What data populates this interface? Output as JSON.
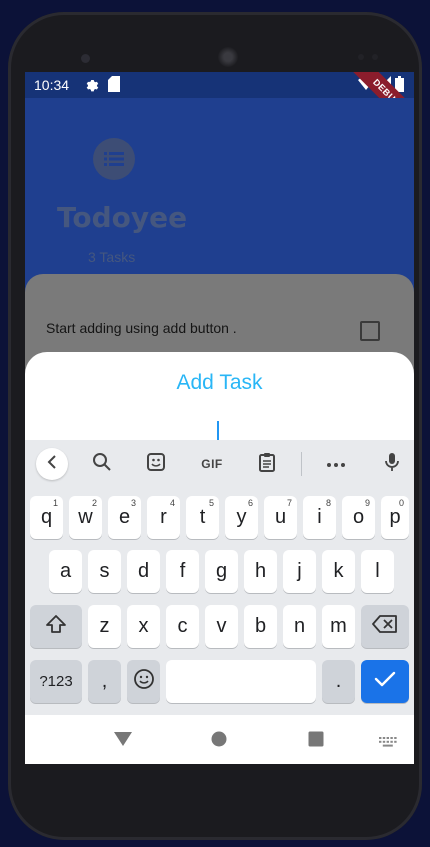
{
  "status_bar": {
    "time": "10:34",
    "debug_label": "DEBUG"
  },
  "app": {
    "title": "Todoyee",
    "task_count": "3 Tasks"
  },
  "list": {
    "empty_message": "Start adding using  add button ."
  },
  "sheet": {
    "title": "Add Task",
    "input_value": ""
  },
  "keyboard": {
    "toolbar_gif": "GIF",
    "row1": [
      "q",
      "w",
      "e",
      "r",
      "t",
      "y",
      "u",
      "i",
      "o",
      "p"
    ],
    "row1_hints": [
      "1",
      "2",
      "3",
      "4",
      "5",
      "6",
      "7",
      "8",
      "9",
      "0"
    ],
    "row2": [
      "a",
      "s",
      "d",
      "f",
      "g",
      "h",
      "j",
      "k",
      "l"
    ],
    "row3": [
      "z",
      "x",
      "c",
      "v",
      "b",
      "n",
      "m"
    ],
    "symbols_label": "?123",
    "comma": ",",
    "period": "."
  },
  "colors": {
    "accent": "#29b6f6",
    "app_bar": "#1f3f8f",
    "enter_key": "#1a73e8"
  }
}
